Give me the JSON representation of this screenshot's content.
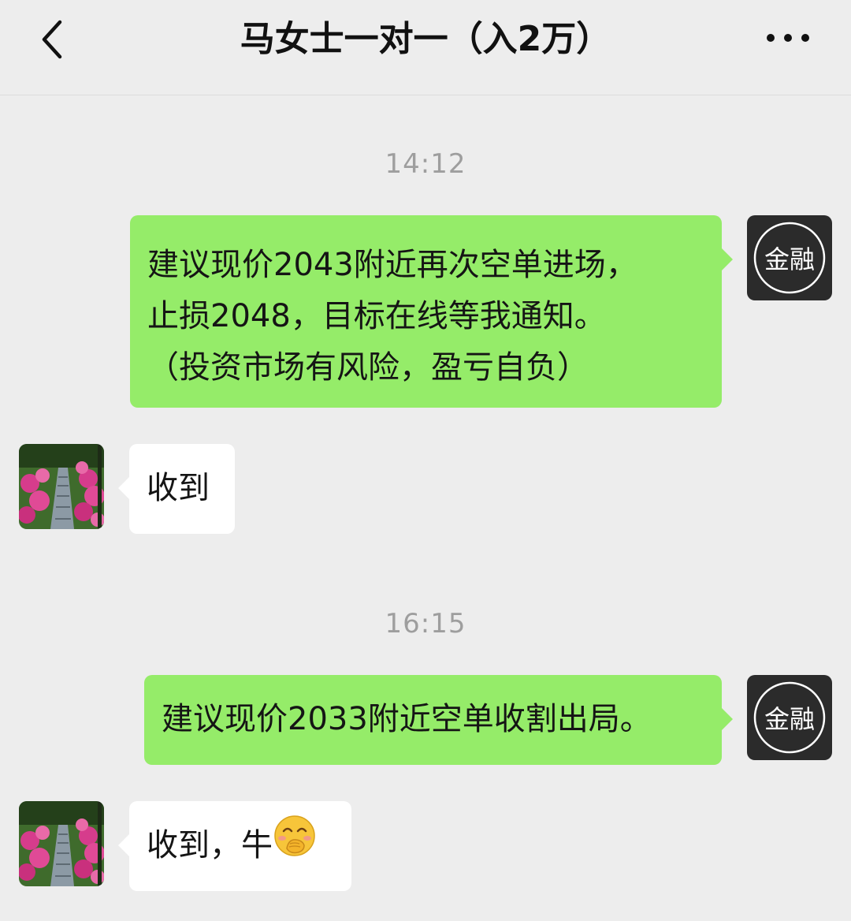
{
  "header": {
    "title": "马女士一对一（入2万）",
    "back_icon": "chevron-left-icon",
    "more_icon": "more-dots-icon"
  },
  "messages": [
    {
      "type": "timestamp",
      "text": "14:12"
    },
    {
      "type": "sent",
      "avatar_text": "金融",
      "lines": [
        "建议现价2043附近再次空单进场，",
        "止损2048，目标在线等我通知。",
        "（投资市场有风险，盈亏自负）"
      ]
    },
    {
      "type": "received",
      "text": "收到"
    },
    {
      "type": "timestamp",
      "text": "16:15"
    },
    {
      "type": "sent",
      "avatar_text": "金融",
      "lines": [
        "建议现价2033附近空单收割出局。"
      ]
    },
    {
      "type": "received",
      "text": "收到，牛",
      "emoji": "hand-over-mouth-emoji"
    }
  ],
  "colors": {
    "background": "#ededed",
    "sent_bubble": "#95ec69",
    "received_bubble": "#ffffff",
    "timestamp_text": "#9e9e9e",
    "self_avatar_bg": "#2b2b2b"
  }
}
